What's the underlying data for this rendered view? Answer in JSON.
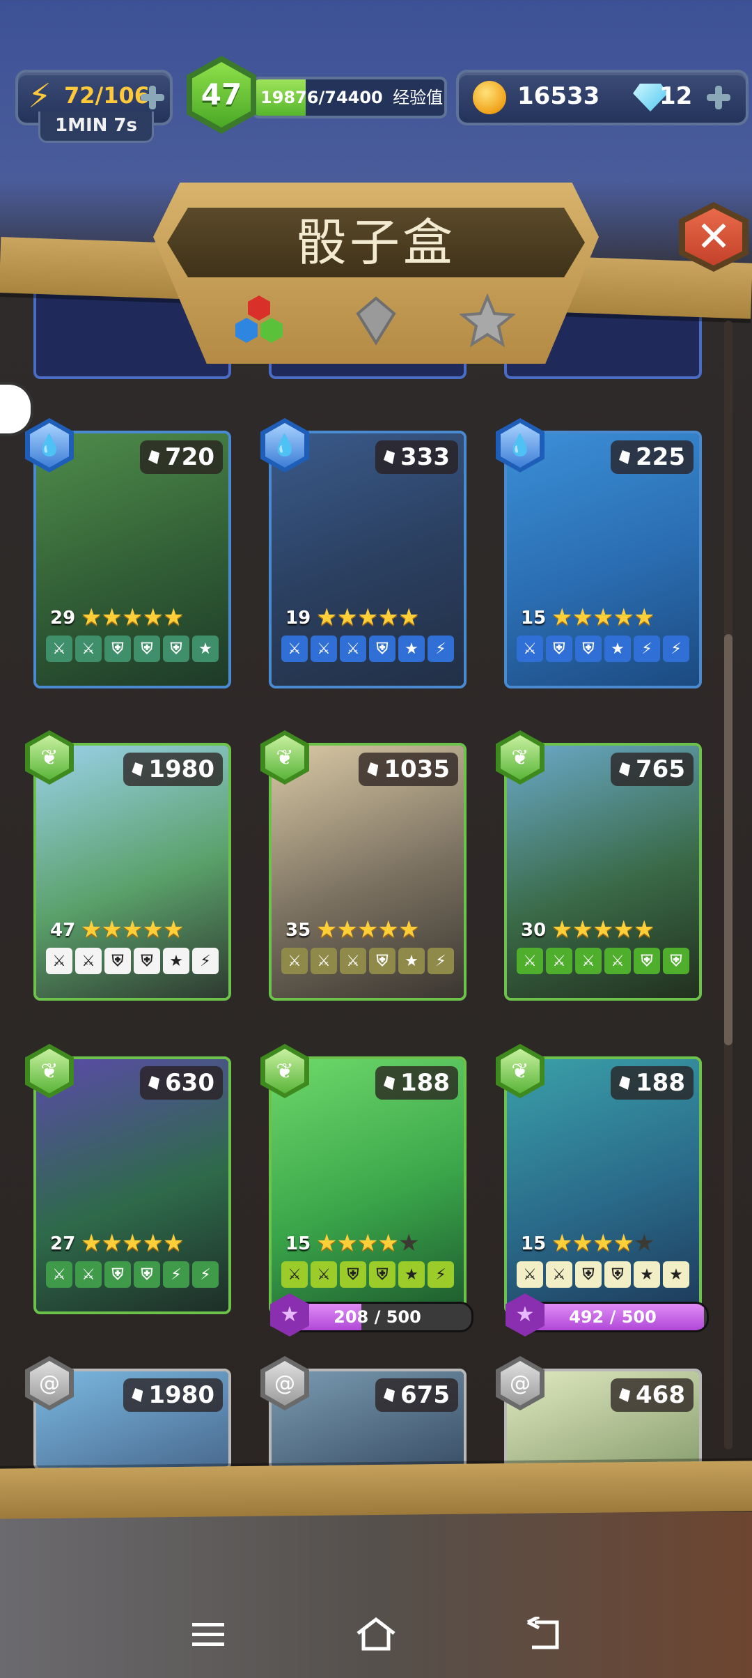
{
  "resources": {
    "energy": "72/106",
    "energy_timer": "1MIN 7s",
    "level": "47",
    "xp": "19876/74400",
    "xp_fraction": 0.267,
    "xp_label": "经验值",
    "gold": "16533",
    "gems": "12"
  },
  "header": {
    "title": "骰子盒",
    "close_icon": "close-x-icon",
    "filters": [
      "multicolor-hex-filter",
      "grey-diamond-filter",
      "grey-star-filter"
    ]
  },
  "colors": {
    "water": "#3e7ed6",
    "earth": "#5ab53a",
    "neutral": "#9a9a9a",
    "progress": "#c05ae6"
  },
  "cards": [
    {
      "element": "water",
      "cost": "720",
      "level": "29",
      "stars": 5,
      "art": "frog-monster",
      "faces": [
        "sword",
        "sword",
        "shield",
        "shield",
        "shield",
        "star"
      ],
      "face_color": "#3f8f6a"
    },
    {
      "element": "water",
      "cost": "333",
      "level": "19",
      "stars": 5,
      "art": "crocodile-monster",
      "faces": [
        "sword",
        "sword",
        "sword",
        "shield",
        "star",
        "bolt"
      ],
      "face_color": "#2f6fd6"
    },
    {
      "element": "water",
      "cost": "225",
      "level": "15",
      "stars": 5,
      "art": "sea-dragon",
      "faces": [
        "sword",
        "shield",
        "shield",
        "star",
        "bolt",
        "bolt"
      ],
      "face_color": "#2f6fd6"
    },
    {
      "element": "earth",
      "cost": "1980",
      "level": "47",
      "stars": 5,
      "art": "panda",
      "faces": [
        "sword",
        "sword",
        "shield",
        "shield",
        "star",
        "bolt"
      ],
      "face_color": "#f4f4f4"
    },
    {
      "element": "earth",
      "cost": "1035",
      "level": "35",
      "stars": 5,
      "art": "cyclops",
      "faces": [
        "sword",
        "sword",
        "sword",
        "shield",
        "star",
        "bolt"
      ],
      "face_color": "#8f8a4a"
    },
    {
      "element": "earth",
      "cost": "765",
      "level": "30",
      "stars": 5,
      "art": "orc",
      "faces": [
        "sword",
        "sword",
        "sword",
        "sword",
        "shield",
        "shield"
      ],
      "face_color": "#4fae2c"
    },
    {
      "element": "earth",
      "cost": "630",
      "level": "27",
      "stars": 5,
      "art": "hydra-plant",
      "faces": [
        "sword",
        "sword",
        "shield",
        "shield",
        "bolt",
        "bolt"
      ],
      "face_color": "#3f9a4a"
    },
    {
      "element": "earth",
      "cost": "188",
      "level": "15",
      "stars": 4,
      "art": "slime-eye",
      "faces": [
        "sword",
        "sword",
        "shield",
        "shield",
        "star",
        "bolt"
      ],
      "face_color": "#9ccc2a",
      "progress": "208 / 500",
      "progress_fraction": 0.416
    },
    {
      "element": "earth",
      "cost": "188",
      "level": "15",
      "stars": 4,
      "art": "unicorn",
      "faces": [
        "sword",
        "sword",
        "shield",
        "shield",
        "star",
        "star"
      ],
      "face_color": "#f2efc6",
      "progress": "492 / 500",
      "progress_fraction": 0.984
    },
    {
      "element": "neutral",
      "cost": "1980",
      "level": "",
      "stars": 0,
      "art": "old-wizard",
      "faces": []
    },
    {
      "element": "neutral",
      "cost": "675",
      "level": "",
      "stars": 0,
      "art": "helmet-knight",
      "faces": []
    },
    {
      "element": "neutral",
      "cost": "468",
      "level": "",
      "stars": 0,
      "art": "white-haired-creature",
      "faces": []
    }
  ],
  "navbar": [
    "menu-icon",
    "home-icon",
    "back-icon"
  ]
}
